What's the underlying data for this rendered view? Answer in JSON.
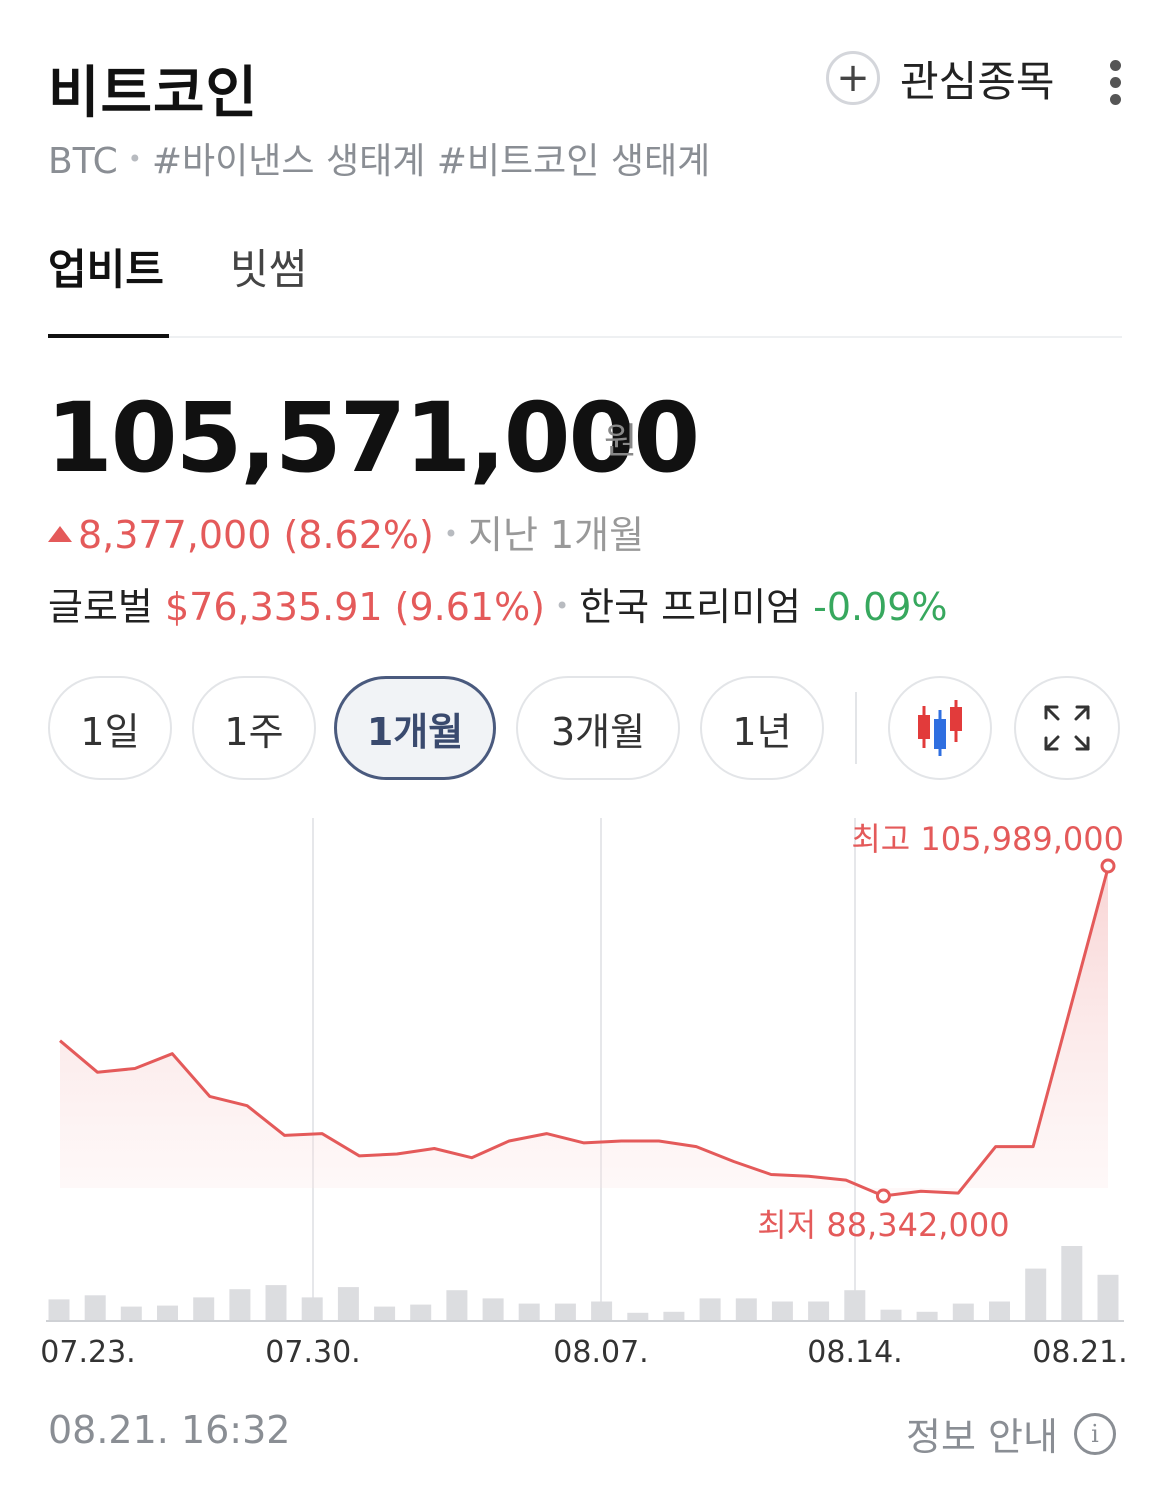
{
  "header": {
    "title": "비트코인",
    "watch_label": "관심종목",
    "ticker": "BTC",
    "tags": "#바이낸스 생태계 #비트코인 생태계"
  },
  "tabs": [
    {
      "label": "업비트",
      "active": true
    },
    {
      "label": "빗썸",
      "active": false
    }
  ],
  "price": {
    "value": "105,571,000",
    "unit": "원",
    "change": "8,377,000 (8.62%)",
    "period_text": "지난 1개월",
    "global_label": "글로벌",
    "global_value": "$76,335.91 (9.61%)",
    "premium_label": "한국 프리미엄",
    "premium_value": "-0.09%"
  },
  "periods": [
    "1일",
    "1주",
    "1개월",
    "3개월",
    "1년"
  ],
  "active_period": "1개월",
  "icons": {
    "candle": "candlestick-chart-icon",
    "expand": "expand-icon",
    "info": "info-icon",
    "plus": "plus-icon",
    "more": "more-vertical-icon"
  },
  "colors": {
    "up": "#e45a5a",
    "down": "#37a85e",
    "volume": "#dcdde0",
    "accent": "#4a5a7e"
  },
  "chart_data": {
    "type": "line",
    "x_ticks": [
      "07.23.",
      "07.30.",
      "08.07.",
      "08.14.",
      "08.21."
    ],
    "values": [
      96700000,
      95000000,
      95200000,
      96000000,
      93700000,
      93200000,
      91600000,
      91700000,
      90500000,
      90600000,
      90900000,
      90400000,
      91300000,
      91700000,
      91200000,
      91300000,
      91300000,
      91000000,
      90200000,
      89500000,
      89400000,
      89200000,
      88342000,
      88600000,
      88500000,
      91000000,
      91000000,
      98500000,
      105989000
    ],
    "volume": [
      2,
      2.4,
      1.3,
      1.4,
      2.2,
      3,
      3.4,
      2.2,
      3.2,
      1.3,
      1.5,
      2.9,
      2.1,
      1.6,
      1.6,
      1.8,
      0.7,
      0.8,
      2.1,
      2.1,
      1.8,
      1.8,
      2.9,
      1,
      0.8,
      1.6,
      1.8,
      5,
      7.2,
      4.4
    ],
    "max_label": "최고 105,989,000",
    "min_label": "최저 88,342,000",
    "ylim": [
      80000000,
      108000000
    ]
  },
  "footer": {
    "timestamp": "08.21. 16:32",
    "info_label": "정보 안내"
  }
}
